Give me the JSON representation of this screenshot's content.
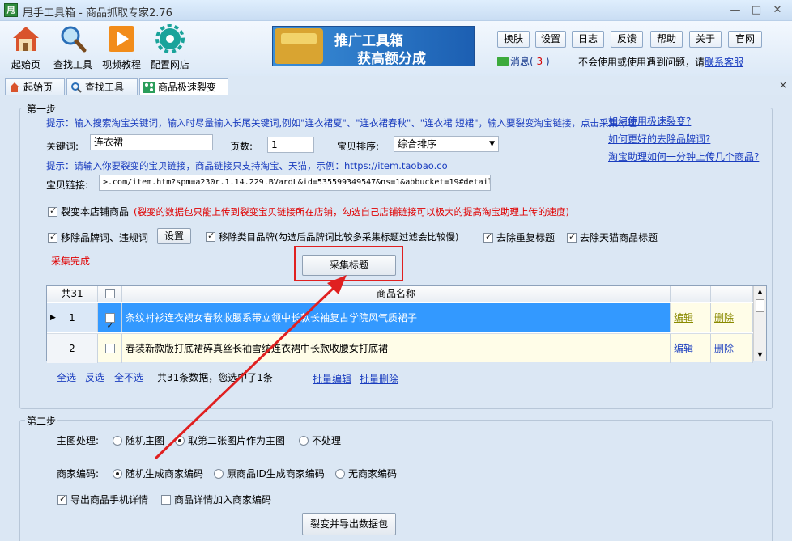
{
  "window": {
    "app_icon_text": "甩",
    "title": "甩手工具箱 - 商品抓取专家2.76",
    "minimize": "—",
    "maximize": "□",
    "close": "✕"
  },
  "toolbar": {
    "buttons": [
      {
        "label": "起始页",
        "icon": "home-icon"
      },
      {
        "label": "查找工具",
        "icon": "magnifier-icon"
      },
      {
        "label": "视频教程",
        "icon": "play-icon"
      },
      {
        "label": "配置网店",
        "icon": "gear-icon"
      }
    ],
    "banner": {
      "line1": "推广工具箱",
      "line2": "获高额分成"
    },
    "top_buttons": [
      "换肤",
      "设置",
      "日志",
      "反馈",
      "帮助",
      "关于",
      "官网"
    ],
    "message": {
      "label": "消息(",
      "count": "3",
      "suffix": ")"
    },
    "notice": {
      "text": "不会使用或使用遇到问题，请",
      "link": "联系客服"
    }
  },
  "tabs": [
    {
      "label": "起始页",
      "icon": "home-icon"
    },
    {
      "label": "查找工具",
      "icon": "magnifier-icon"
    },
    {
      "label": "商品极速裂变",
      "icon": "split-icon"
    }
  ],
  "tab_close": "×",
  "step1": {
    "title": "第一步",
    "tip1": "提示：输入搜索淘宝关键词，输入时尽量输入长尾关键词,例如\"连衣裙夏\"、\"连衣裙春秋\"、\"连衣裙 短裙\"，输入要裂变淘宝链接，点击采集标题",
    "help_links": [
      "如何使用极速裂变?",
      "如何更好的去除品牌词?",
      "淘宝助理如何一分钟上传几个商品?"
    ],
    "keyword_label": "关键词:",
    "keyword_value": "连衣裙",
    "pages_label": "页数:",
    "pages_value": "1",
    "sort_label": "宝贝排序:",
    "sort_value": "综合排序",
    "tip2": "提示：请输入你要裂变的宝贝链接，商品链接只支持淘宝、天猫，示例：https://item.taobao.co",
    "link_label": "宝贝链接:",
    "link_value": ">.com/item.htm?spm=a230r.1.14.229.BVardL&id=535599349547&ns=1&abbucket=19#detail",
    "shop_only_label": "裂变本店铺商品",
    "shop_only_note": "(裂变的数据包只能上传到裂变宝贝链接所在店铺，勾选自己店铺链接可以极大的提高淘宝助理上传的速度)",
    "remove_brand_label": "移除品牌词、违规词",
    "settings_button": "设置",
    "remove_category_label": "移除类目品牌(勾选后品牌词比较多采集标题过滤会比较慢)",
    "dedupe_label": "去除重复标题",
    "remove_tmall_label": "去除天猫商品标题",
    "status": "采集完成",
    "collect_button": "采集标题"
  },
  "table": {
    "count_header": "共31",
    "name_header": "商品名称",
    "rows": [
      {
        "index": "1",
        "name": "条纹衬衫连衣裙女春秋收腰系带立领中长款长袖复古学院风气质裙子",
        "edit": "编辑",
        "delete": "删除"
      },
      {
        "index": "2",
        "name": "春装新款版打底裙碎真丝长袖雪纺连衣裙中长款收腰女打底裙",
        "edit": "编辑",
        "delete": "删除"
      }
    ]
  },
  "table_footer": {
    "select_all": "全选",
    "invert": "反选",
    "select_none": "全不选",
    "summary": "共31条数据，您选中了1条",
    "batch_edit": "批量编辑",
    "batch_delete": "批量删除"
  },
  "step2": {
    "title": "第二步",
    "main_image_label": "主图处理:",
    "main_image_options": [
      "随机主图",
      "取第二张图片作为主图",
      "不处理"
    ],
    "merchant_code_label": "商家编码:",
    "merchant_code_options": [
      "随机生成商家编码",
      "原商品ID生成商家编码",
      "无商家编码"
    ],
    "export_mobile_label": "导出商品手机详情",
    "add_code_label": "商品详情加入商家编码",
    "export_button": "裂变并导出数据包"
  },
  "colors": {
    "accent_red": "#e00000",
    "link_blue": "#1a3dbf",
    "selected_row": "#3399ff",
    "row_alt": "#fffde8"
  }
}
